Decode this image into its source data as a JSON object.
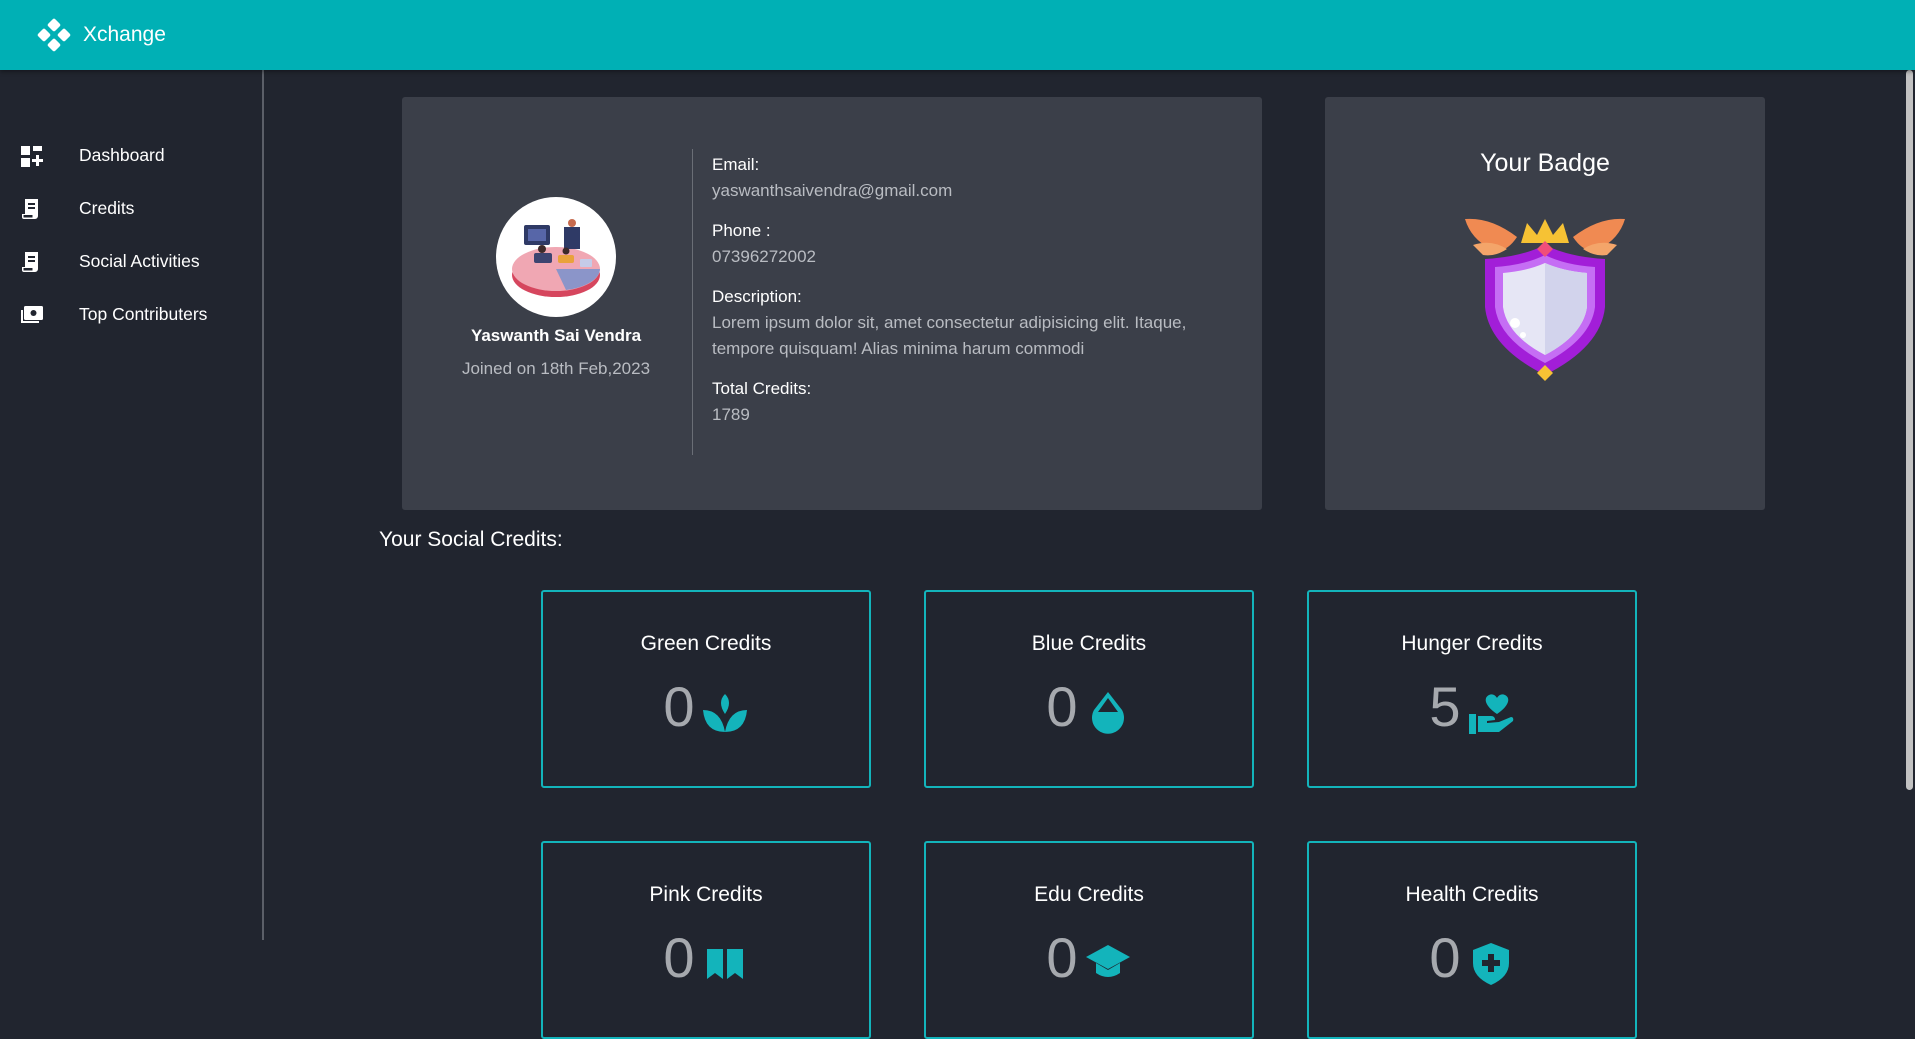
{
  "brand": {
    "name": "Xchange"
  },
  "sidebar": {
    "items": [
      {
        "label": "Dashboard",
        "icon": "dashboard-add-icon"
      },
      {
        "label": "Credits",
        "icon": "receipt-icon"
      },
      {
        "label": "Social Activities",
        "icon": "receipt-icon"
      },
      {
        "label": "Top Contributers",
        "icon": "money-icon"
      }
    ]
  },
  "profile": {
    "name": "Yaswanth Sai Vendra",
    "joined": "Joined on 18th Feb,2023",
    "email_label": "Email:",
    "email": "yaswanthsaivendra@gmail.com",
    "phone_label": "Phone :",
    "phone": "07396272002",
    "description_label": "Description:",
    "description": "Lorem ipsum dolor sit, amet consectetur adipisicing elit. Itaque, tempore quisquam! Alias minima harum commodi",
    "total_credits_label": "Total Credits:",
    "total_credits": "1789"
  },
  "badge": {
    "title": "Your Badge",
    "icon": "shield-badge-icon"
  },
  "social": {
    "title": "Your Social Credits:",
    "cards": [
      {
        "title": "Green Credits",
        "value": "0",
        "icon": "sprout-icon"
      },
      {
        "title": "Blue Credits",
        "value": "0",
        "icon": "water-drop-icon"
      },
      {
        "title": "Hunger Credits",
        "value": "5",
        "icon": "hand-heart-icon"
      },
      {
        "title": "Pink Credits",
        "value": "0",
        "icon": "ribbon-icon"
      },
      {
        "title": "Edu Credits",
        "value": "0",
        "icon": "school-icon"
      },
      {
        "title": "Health Credits",
        "value": "0",
        "icon": "health-shield-icon"
      }
    ]
  },
  "colors": {
    "topbar": "#00b0b5",
    "background": "#21252f",
    "card": "#3b3f49",
    "accent": "#13b4bb",
    "muted_text": "#b9bcc2"
  }
}
